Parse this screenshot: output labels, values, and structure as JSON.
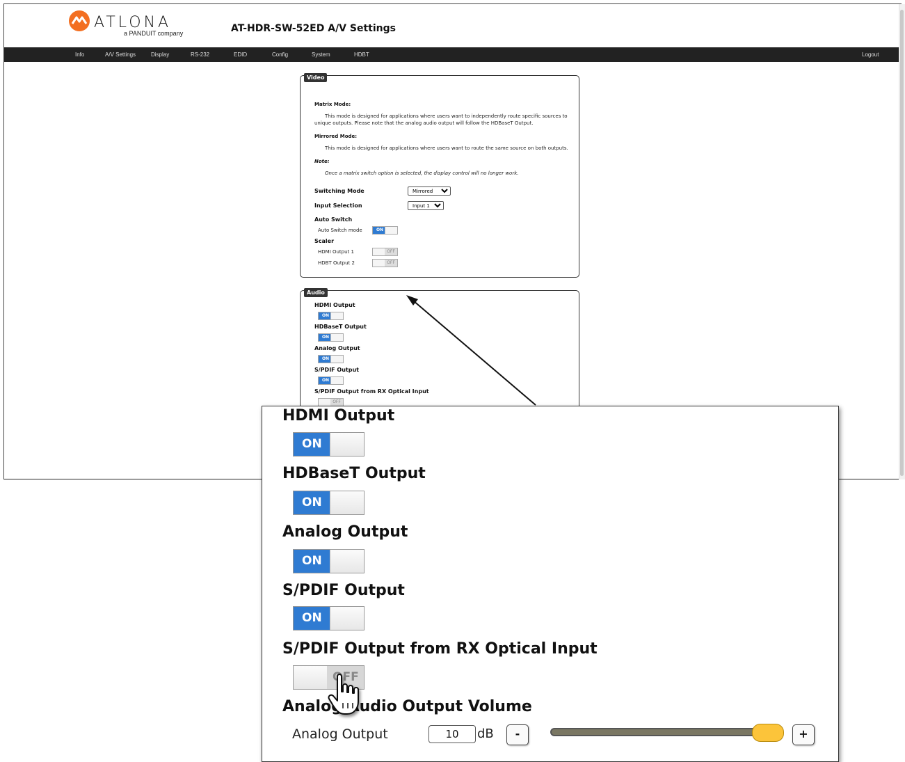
{
  "header": {
    "brand": "ATLONA",
    "brand_sub": "a PANDUIT company",
    "title": "AT-HDR-SW-52ED  A/V Settings"
  },
  "nav": {
    "items": [
      "Info",
      "A/V Settings",
      "Display",
      "RS-232",
      "EDID",
      "Config",
      "System",
      "HDBT"
    ],
    "logout": "Logout"
  },
  "video": {
    "legend": "Video",
    "matrix_title": "Matrix Mode:",
    "matrix_text_1": "This mode is designed for applications where users want to independently route specific sources to",
    "matrix_text_2": "unique outputs. Please note that the analog audio output will follow the HDBaseT Output.",
    "mirrored_title": "Mirrored Mode:",
    "mirrored_text": "This mode is designed for applications where users want to route the same source on both outputs.",
    "note_title": "Note:",
    "note_text": "Once a matrix switch option is selected, the display control will no longer work.",
    "switching_mode_label": "Switching Mode",
    "switching_mode_value": "Mirrored",
    "input_selection_label": "Input Selection",
    "input_selection_value": "Input 1",
    "auto_switch_label": "Auto Switch",
    "auto_switch_mode_label": "Auto Switch mode",
    "auto_switch_state": "ON",
    "scaler_label": "Scaler",
    "hdmi_output_1_label": "HDMI Output 1",
    "hdmi_output_1_state": "OFF",
    "hdbt_output_2_label": "HDBT Output 2",
    "hdbt_output_2_state": "OFF"
  },
  "audio": {
    "legend": "Audio",
    "hdmi_output": "HDMI Output",
    "hdbaset_output": "HDBaseT Output",
    "analog_output": "Analog Output",
    "spdif_output": "S/PDIF Output",
    "spdif_rx": "S/PDIF Output from RX Optical Input",
    "on": "ON",
    "off": "OFF"
  },
  "zoom": {
    "hdmi_output": "HDMI Output",
    "hdbaset_output": "HDBaseT Output",
    "analog_output": "Analog Output",
    "spdif_output": "S/PDIF Output",
    "spdif_rx": "S/PDIF Output from RX Optical Input",
    "volume_title": "Analog Audio Output Volume",
    "volume_label": "Analog Output",
    "volume_value": "10",
    "volume_unit": "dB",
    "minus": "-",
    "plus": "+",
    "on": "ON",
    "off": "OFF",
    "slider_level": 1.0
  },
  "colors": {
    "accent": "#2f7bd2",
    "navbar": "#222222",
    "slider_thumb": "#fcc43a",
    "slider_track": "#7a7763",
    "logo": "#f36f21"
  }
}
